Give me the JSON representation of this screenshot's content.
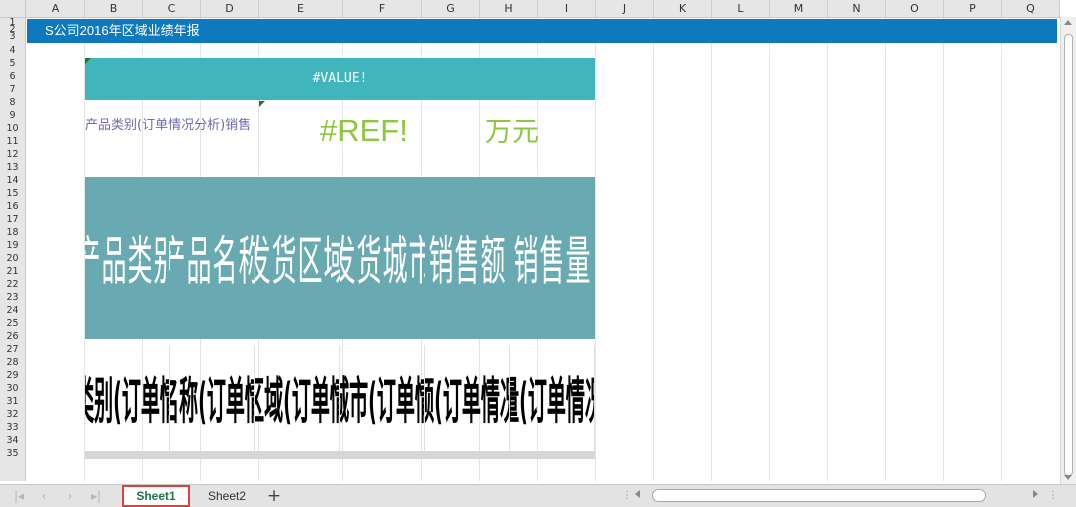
{
  "columns": [
    "A",
    "B",
    "C",
    "D",
    "E",
    "F",
    "G",
    "H",
    "I",
    "J",
    "K",
    "L",
    "M",
    "N",
    "O",
    "P",
    "Q"
  ],
  "rows": [
    "1",
    "2",
    "3",
    "4",
    "5",
    "6",
    "7",
    "8",
    "9",
    "10",
    "11",
    "12",
    "13",
    "14",
    "15",
    "16",
    "17",
    "18",
    "19",
    "20",
    "21",
    "22",
    "23",
    "24",
    "25",
    "26",
    "27",
    "28",
    "29",
    "30",
    "31",
    "32",
    "33",
    "34",
    "35"
  ],
  "report": {
    "title": "S公司2016年区域业绩年报",
    "value_error": "#VALUE!",
    "category_label": "产品类别(订单情况分析)销售",
    "ref_error": "#REF!",
    "unit": "万元"
  },
  "table": {
    "headers": [
      "产品类别",
      "产品名称",
      "发货区域",
      "发货城市",
      "销售额",
      "销售量"
    ],
    "cells": [
      "类别(订单情",
      "名称(订单情",
      "区域(订单情",
      "城市(订单情",
      "额(订单情况",
      "量(订单情况"
    ]
  },
  "sheet_tabs": {
    "active": "Sheet1",
    "other": "Sheet2",
    "add": "+"
  },
  "colors": {
    "title_bar": "#0f79bd",
    "value_banner": "#41b5bc",
    "header_block": "#69aab2",
    "ref_text": "#8dc63f",
    "active_tab_text": "#217346",
    "active_tab_outline": "#e04040"
  }
}
